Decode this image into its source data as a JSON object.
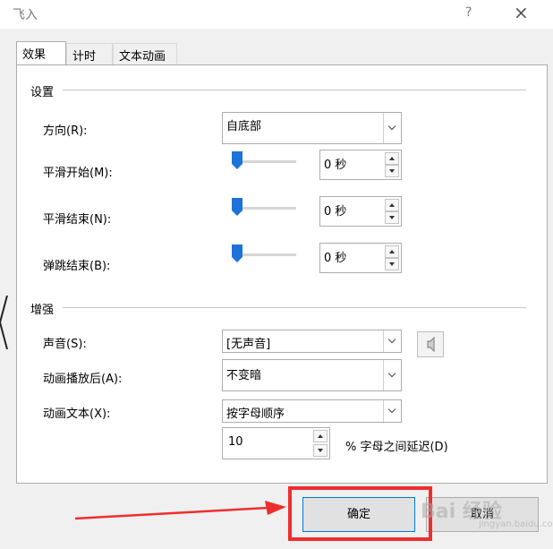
{
  "dialog": {
    "title": "飞入",
    "help_icon": "?",
    "close_icon": "×"
  },
  "tabs": [
    {
      "label": "效果",
      "active": true
    },
    {
      "label": "计时",
      "active": false
    },
    {
      "label": "文本动画",
      "active": false
    }
  ],
  "settings": {
    "group_title": "设置",
    "direction": {
      "label": "方向(R):",
      "value": "自底部"
    },
    "smooth_start": {
      "label": "平滑开始(M):",
      "value": "0 秒",
      "slider_fraction": 0
    },
    "smooth_end": {
      "label": "平滑结束(N):",
      "value": "0 秒",
      "slider_fraction": 0
    },
    "bounce_end": {
      "label": "弹跳结束(B):",
      "value": "0 秒",
      "slider_fraction": 0
    }
  },
  "enhance": {
    "group_title": "增强",
    "sound": {
      "label": "声音(S):",
      "value": "[无声音]",
      "icon": "speaker-icon"
    },
    "after_animation": {
      "label": "动画播放后(A):",
      "value": "不变暗"
    },
    "animate_text": {
      "label": "动画文本(X):",
      "value": "按字母顺序"
    },
    "delay": {
      "value": "10",
      "suffix": "% 字母之间延迟(D)"
    }
  },
  "buttons": {
    "ok": "确定",
    "cancel": "取消"
  },
  "annotation": {
    "highlight_color": "#ee2e2e",
    "arrow_color": "#ee2e2e"
  },
  "watermark": {
    "text": "Bai 经验",
    "sub": "jingyan.baidu.com"
  }
}
